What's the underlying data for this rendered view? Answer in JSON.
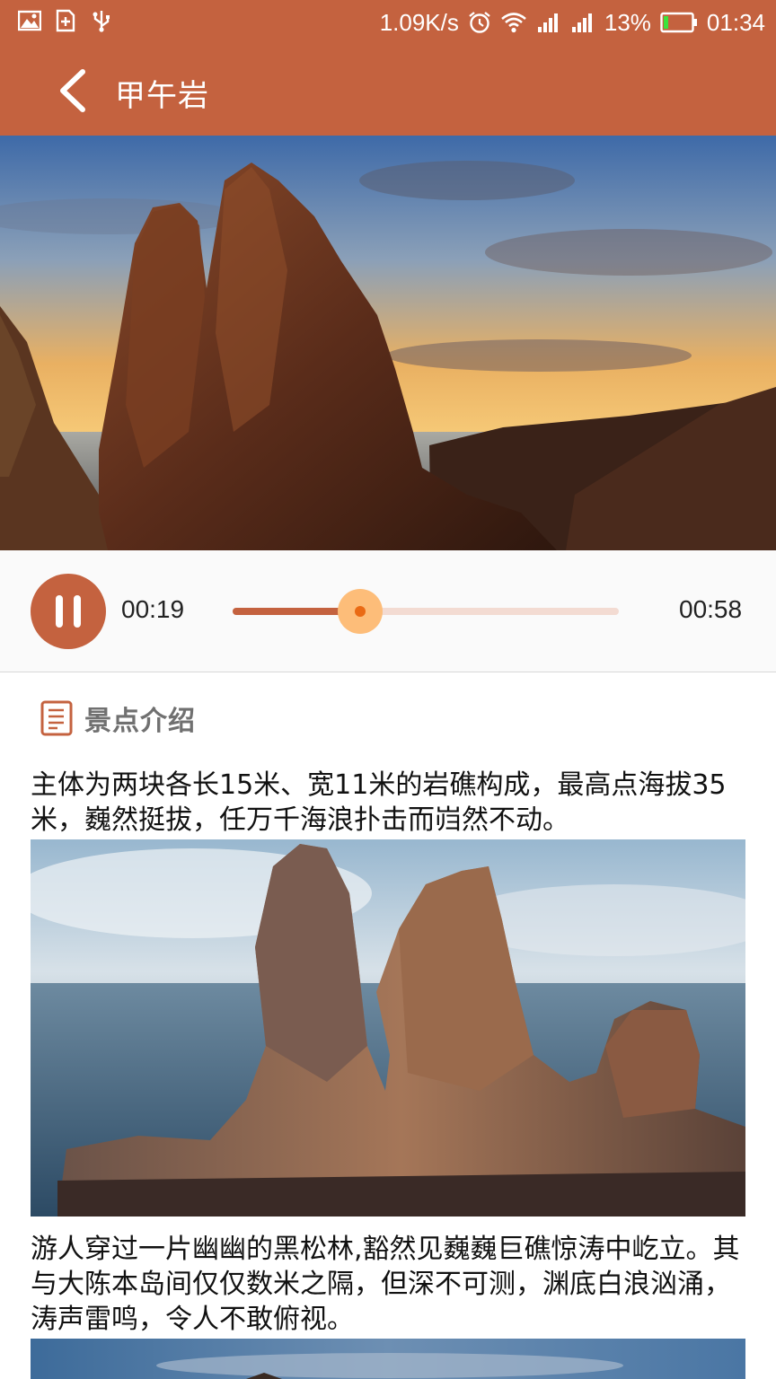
{
  "status_bar": {
    "network_speed": "1.09K/s",
    "battery_percent": "13%",
    "time": "01:34",
    "left_icons": [
      "image-icon",
      "sim-plus-icon",
      "usb-icon"
    ],
    "right_icons": [
      "alarm-icon",
      "wifi-icon",
      "signal-icon",
      "signal-icon",
      "battery-icon"
    ],
    "battery_level": 0.13
  },
  "toolbar": {
    "title": "甲午岩",
    "back_icon": "chevron-left-icon"
  },
  "player": {
    "current_time": "00:19",
    "total_time": "00:58",
    "progress": 0.33,
    "state_icon": "pause-icon"
  },
  "intro": {
    "icon": "document-icon",
    "heading": "景点介绍",
    "paragraphs": [
      "主体为两块各长15米、宽11米的岩礁构成，最高点海拔35米，巍然挺拔，任万千海浪扑击而岿然不动。",
      "游人穿过一片幽幽的黑松林,豁然见巍巍巨礁惊涛中屹立。其与大陈本岛间仅仅数米之隔，但深不可测，渊底白浪汹涌，涛声雷鸣，令人不敢俯视。"
    ]
  },
  "colors": {
    "accent": "#c4623f",
    "thumb": "#fdbd79",
    "track_bg": "#f3dbd2"
  }
}
